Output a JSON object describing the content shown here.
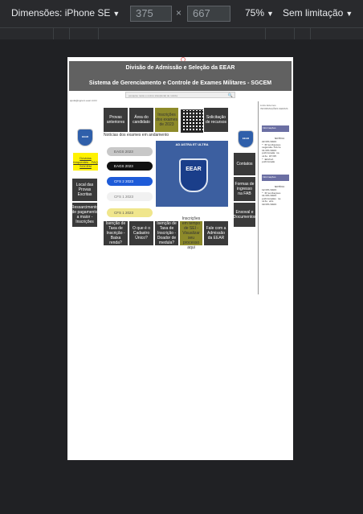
{
  "toolbar": {
    "dimensions_label": "Dimensões: iPhone SE",
    "width_value": "375",
    "times": "×",
    "height_value": "667",
    "zoom": "75%",
    "throttle": "Sem limitação",
    "caret": "▼"
  },
  "site": {
    "header_title": "Divisão de Admissão e Seleção da EEAR",
    "header_subtitle": "Sistema de Gerenciamento e Controle de Exames Militares - SGCEM",
    "search_placeholder": "pesquise neste e outros sites(local) de notícia",
    "search_icon": "🔍",
    "breadcrumb": "ajuda@sgcem.eear.mil.br",
    "top_nav": [
      "Provas anteriores",
      "Área do candidato",
      "Inscrições dos exames de 2023",
      "Solicitação de recursos"
    ],
    "left_nav": [
      "Local das Provas Escritas",
      "Ressarcimento de pagamento a maior - Inscrições"
    ],
    "yellow_link": "Dúvidas frequentes - FAQ SGCEM",
    "right_nav": [
      "Contatos",
      "Formas de ingresso na FAB",
      "Enxoval e Documentos"
    ],
    "bottom_nav": [
      "Isenção de Taxa de Inscrição - Baixa renda?",
      "O que é o Cadastro Único?",
      "Isenção de Taxa de Inscrição - Doador de medula?",
      "Inscrições em tempo de SEI - Visualizar seu processo aqui",
      "Fale com a Admissão da EEAR"
    ],
    "news_title": "Notícias dos exames em andamento",
    "news_items": [
      "EAGS 2023",
      "EAGS 2023",
      "CFS 2 2023",
      "CFS 1 2023",
      "CFS 1 2023"
    ],
    "banner_text": "AD ASTRA ET ULTRA",
    "shield_text": "EEAR",
    "logo_text": "EEAR",
    "right_panel": {
      "top_links": "Links Externos INFORMAÇÕES GERAIS",
      "box1": "Informações",
      "tag1": "NOTÍCIA",
      "text1": "22/05/2023\n* Orientações\nsegunda-feira\n11/05/2023\npublicada no\nsite 07/05\n* Edital\npublicado",
      "box2": "Informações",
      "tag2": "NOTÍCIA",
      "text2": "12/05/2023\n* Orientações\n11/05/2023\npublicadas no\nsite até\n10/05/2023"
    }
  }
}
